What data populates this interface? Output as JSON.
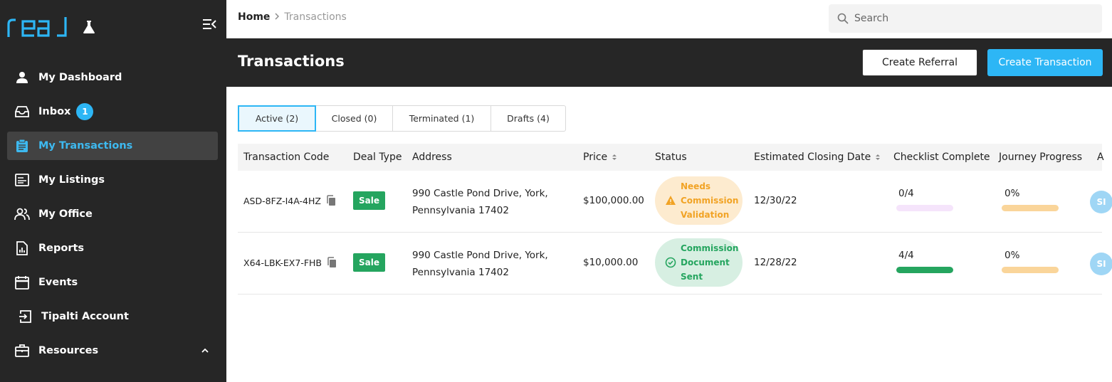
{
  "app": {
    "logo_text": "real"
  },
  "sidebar": {
    "items": [
      {
        "label": "My Dashboard",
        "icon": "person-icon"
      },
      {
        "label": "Inbox",
        "icon": "inbox-icon",
        "badge": "1"
      },
      {
        "label": "My Transactions",
        "icon": "clipboard-icon",
        "active": true
      },
      {
        "label": "My Listings",
        "icon": "listing-icon"
      },
      {
        "label": "My Office",
        "icon": "people-icon"
      },
      {
        "label": "Reports",
        "icon": "report-icon"
      },
      {
        "label": "Events",
        "icon": "calendar-icon"
      },
      {
        "label": "Tipalti Account",
        "icon": "login-icon"
      },
      {
        "label": "Resources",
        "icon": "briefcase-icon",
        "expanded": true
      }
    ]
  },
  "breadcrumb": {
    "home": "Home",
    "separator": ">",
    "current": "Transactions"
  },
  "search": {
    "placeholder": "Search",
    "value": ""
  },
  "header": {
    "title": "Transactions",
    "create_referral": "Create Referral",
    "create_transaction": "Create Transaction"
  },
  "tabs": [
    {
      "label": "Active (2)",
      "active": true
    },
    {
      "label": "Closed (0)"
    },
    {
      "label": "Terminated (1)"
    },
    {
      "label": "Drafts (4)"
    }
  ],
  "table": {
    "columns": [
      "Transaction Code",
      "Deal Type",
      "Address",
      "Price",
      "Status",
      "Estimated Closing Date",
      "Checklist Complete",
      "Journey Progress",
      "A"
    ],
    "rows": [
      {
        "code": "ASD-8FZ-I4A-4HZ",
        "deal_type": "Sale",
        "address_line1": "990 Castle Pond Drive, York,",
        "address_line2": "Pennsylvania 17402",
        "price": "$100,000.00",
        "status_lines": [
          "Needs",
          "Commission",
          "Validation"
        ],
        "status_kind": "warning",
        "closing_date": "12/30/22",
        "checklist": "0/4",
        "checklist_fraction": 0,
        "journey": "0%",
        "journey_fraction": 0,
        "avatar": "SI"
      },
      {
        "code": "X64-LBK-EX7-FHB",
        "deal_type": "Sale",
        "address_line1": "990 Castle Pond Drive, York,",
        "address_line2": "Pennsylvania 17402",
        "price": "$10,000.00",
        "status_lines": [
          "Commission",
          "Document",
          "Sent"
        ],
        "status_kind": "success",
        "closing_date": "12/28/22",
        "checklist": "4/4",
        "checklist_fraction": 1,
        "journey": "0%",
        "journey_fraction": 0,
        "avatar": "SI"
      }
    ]
  },
  "colors": {
    "sidebar_bg": "#262626",
    "accent": "#2db6f5",
    "sale_green": "#25a55f",
    "warn_orange": "#f1a325",
    "checklist_track": "#f5e4fb",
    "journey_track": "#fad59a"
  }
}
